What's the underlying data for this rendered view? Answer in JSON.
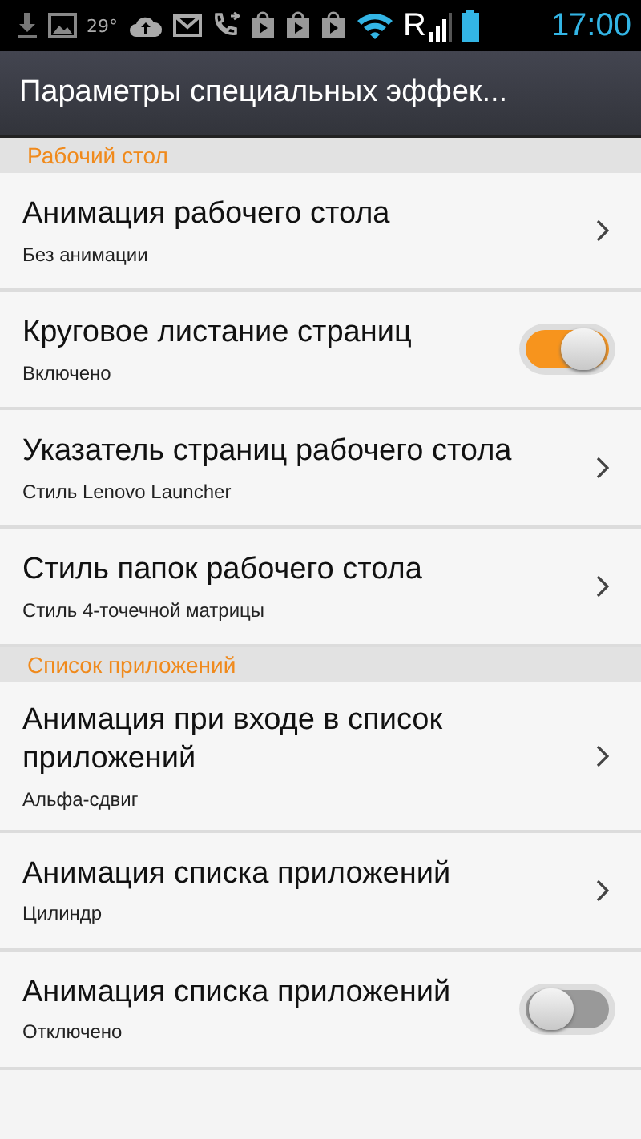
{
  "status_bar": {
    "temperature": "29°",
    "network": "R",
    "time": "17:00"
  },
  "action_bar": {
    "title": "Параметры специальных эффек..."
  },
  "sections": [
    {
      "header": "Рабочий стол",
      "items": [
        {
          "kind": "link",
          "title": "Анимация рабочего стола",
          "summary": "Без анимации"
        },
        {
          "kind": "toggle",
          "title": "Круговое листание страниц",
          "summary": "Включено",
          "on": true
        },
        {
          "kind": "link",
          "title": "Указатель страниц рабочего стола",
          "summary": "Стиль Lenovo Launcher"
        },
        {
          "kind": "link",
          "title": "Стиль папок рабочего стола",
          "summary": "Стиль 4-точечной матрицы"
        }
      ]
    },
    {
      "header": "Список приложений",
      "items": [
        {
          "kind": "link",
          "title": "Анимация при входе в список приложений",
          "summary": "Альфа-сдвиг"
        },
        {
          "kind": "link",
          "title": "Анимация списка приложений",
          "summary": "Цилиндр"
        },
        {
          "kind": "toggle",
          "title": "Анимация списка приложений",
          "summary": "Отключено",
          "on": false
        }
      ]
    }
  ]
}
